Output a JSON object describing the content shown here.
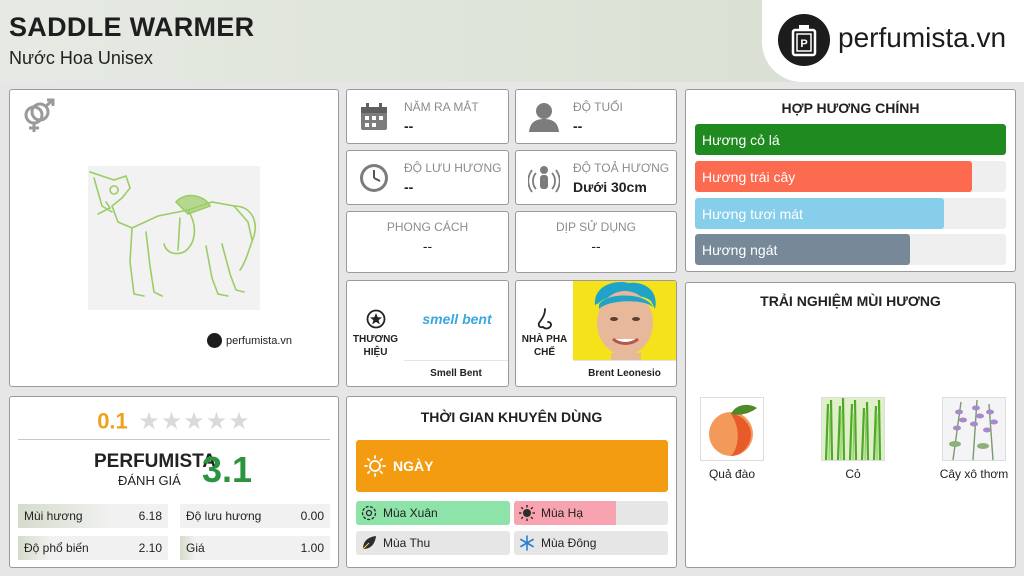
{
  "product": {
    "name": "SADDLE WARMER",
    "category": "Nước Hoa Unisex"
  },
  "brand_logo": {
    "text": "perfumista.vn",
    "small_text": "perfumista.vn"
  },
  "icons": {
    "gender": "gender-unisex-icon",
    "year": "calendar-icon",
    "age": "person-icon",
    "longevity": "clock-icon",
    "sillage": "sillage-person-icon",
    "brand": "star-badge-icon",
    "perfumer": "nose-icon",
    "day": "sun-icon"
  },
  "stats": {
    "year": {
      "label": "NĂM RA MẮT",
      "value": "--"
    },
    "age": {
      "label": "ĐỘ TUỔI",
      "value": "--"
    },
    "longevity": {
      "label": "ĐỘ LƯU HƯƠNG",
      "value": "--"
    },
    "sillage": {
      "label": "ĐỘ TOẢ HƯƠNG",
      "value": "Dưới 30cm"
    },
    "style": {
      "label": "PHONG CÁCH",
      "value": "--"
    },
    "occasion": {
      "label": "DỊP SỬ DỤNG",
      "value": "--"
    }
  },
  "brand": {
    "label": "THƯƠNG HIỆU",
    "name": "Smell Bent",
    "logo_text": "smell bent"
  },
  "perfumer": {
    "label": "NHÀ PHA CHẾ",
    "name": "Brent Leonesio"
  },
  "rating": {
    "user_score": "0.1",
    "stars_filled": 0,
    "stars_total": 5,
    "perfumista_label": "PERFUMISTA",
    "perfumista_sub": "ĐÁNH GIÁ",
    "perfumista_score": "3.1",
    "metrics": [
      {
        "label": "Mùi hương",
        "value": "6.18",
        "fraction": 0.62
      },
      {
        "label": "Độ lưu hương",
        "value": "0.00",
        "fraction": 0.0
      },
      {
        "label": "Độ phổ biến",
        "value": "2.10",
        "fraction": 0.21
      },
      {
        "label": "Giá",
        "value": "1.00",
        "fraction": 0.1
      }
    ]
  },
  "time": {
    "title": "THỜI GIAN KHUYÊN DÙNG",
    "day_label": "NGÀY",
    "day_color": "#f39c12",
    "seasons": [
      {
        "label": "Mùa Xuân",
        "fraction": 1.0,
        "color": "#8ee3a8",
        "icon": "flower-icon"
      },
      {
        "label": "Mùa Hạ",
        "fraction": 0.66,
        "color": "#f7a3b0",
        "icon": "sun-icon"
      },
      {
        "label": "Mùa Thu",
        "fraction": 0.0,
        "color": "#f7d96a",
        "icon": "leaf-icon"
      },
      {
        "label": "Mùa Đông",
        "fraction": 0.0,
        "color": "#8cc6f0",
        "icon": "snowflake-icon"
      }
    ]
  },
  "accords": {
    "title": "HỢP HƯƠNG CHÍNH",
    "items": [
      {
        "label": "Hương cỏ lá",
        "fraction": 1.0,
        "color": "#1f8a1f"
      },
      {
        "label": "Hương trái cây",
        "fraction": 0.89,
        "color": "#fc6a4f"
      },
      {
        "label": "Hương tươi mát",
        "fraction": 0.8,
        "color": "#87ceeb"
      },
      {
        "label": "Hương ngát",
        "fraction": 0.69,
        "color": "#778899"
      }
    ]
  },
  "notes": {
    "title": "TRẢI NGHIỆM MÙI HƯƠNG",
    "items": [
      {
        "label": "Quả đào"
      },
      {
        "label": "Cỏ"
      },
      {
        "label": "Cây xô thơm"
      }
    ]
  }
}
